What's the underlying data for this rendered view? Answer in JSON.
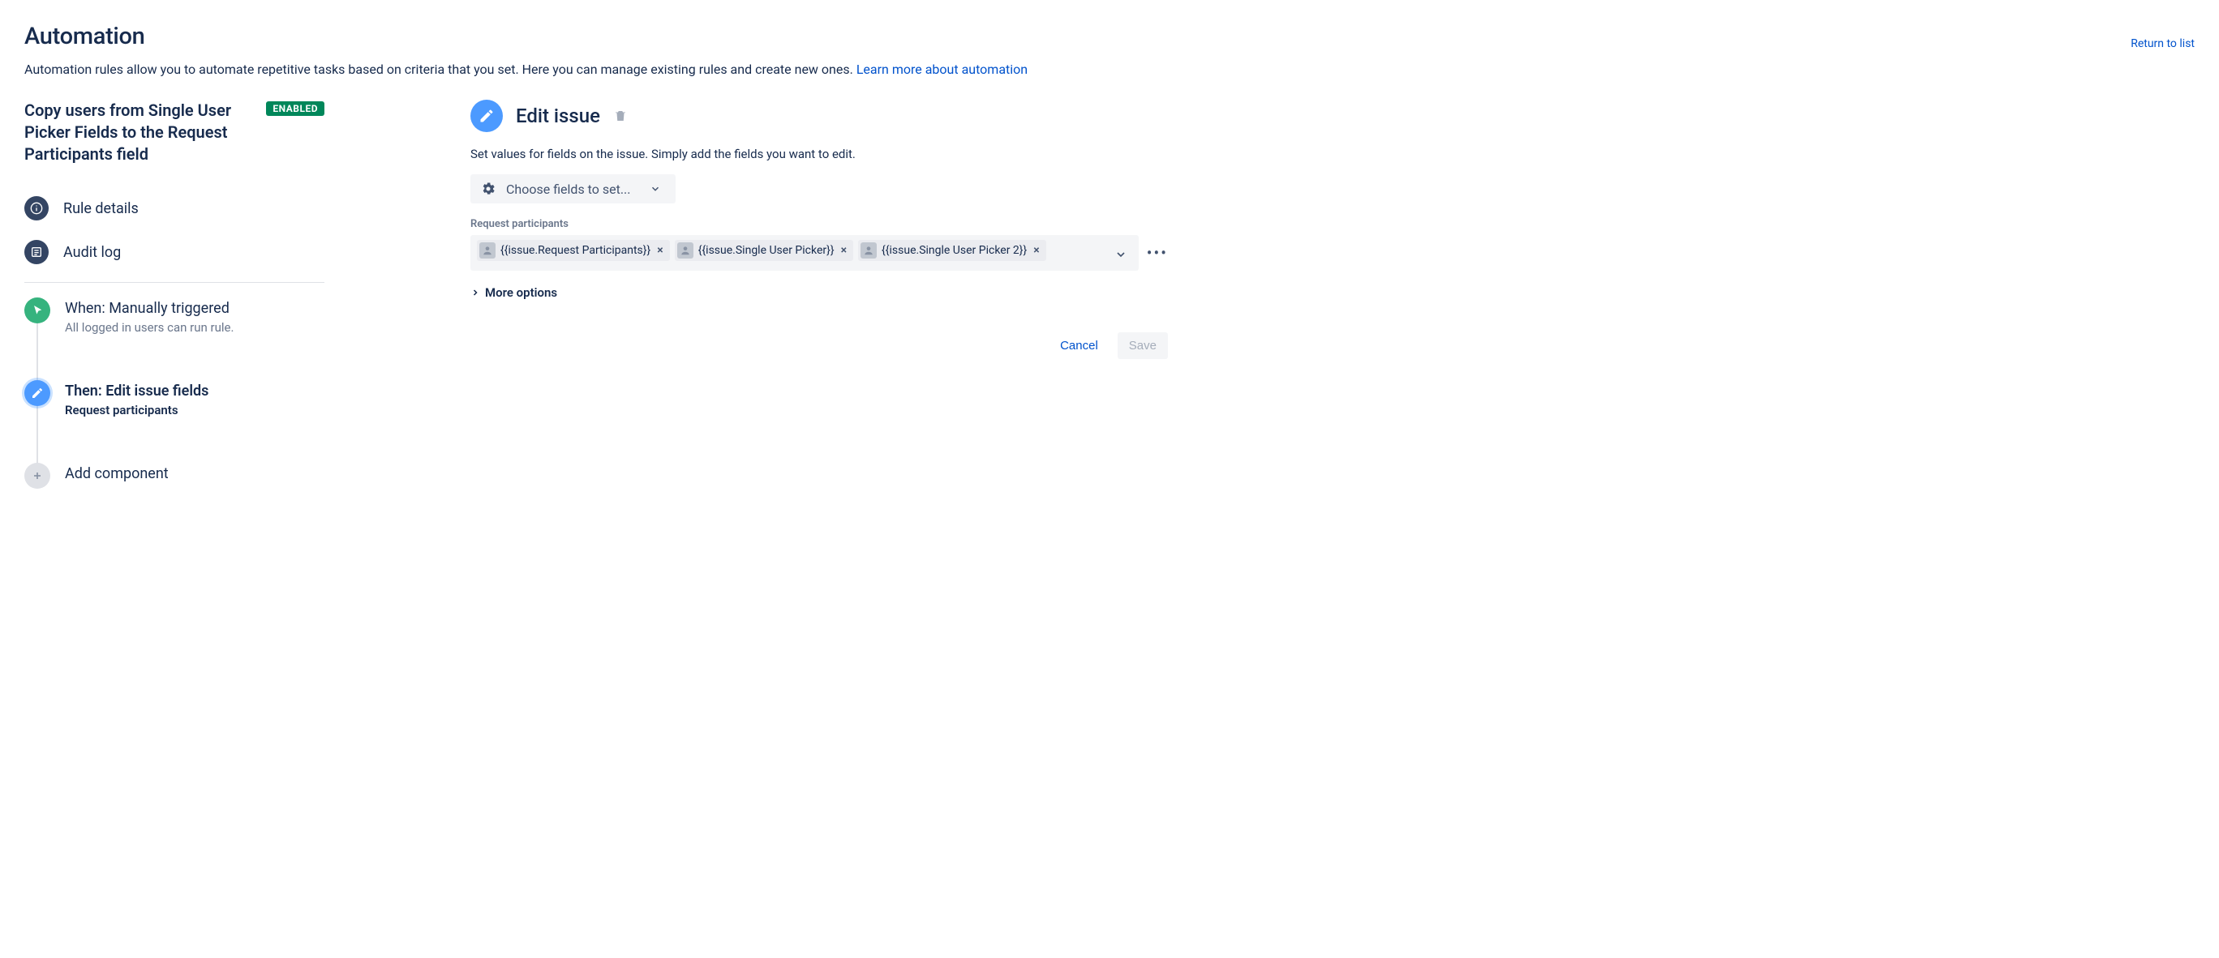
{
  "header": {
    "title": "Automation",
    "return_link": "Return to list",
    "description_prefix": "Automation rules allow you to automate repetitive tasks based on criteria that you set. Here you can manage existing rules and create new ones. ",
    "learn_more": "Learn more about automation"
  },
  "rule": {
    "name": "Copy users from Single User Picker Fields to the Request Participants field",
    "status": "ENABLED"
  },
  "sidebar": {
    "rule_details": "Rule details",
    "audit_log": "Audit log"
  },
  "flow": {
    "trigger": {
      "title": "When: Manually triggered",
      "sub": "All logged in users can run rule."
    },
    "action": {
      "title": "Then: Edit issue fields",
      "sub": "Request participants"
    },
    "add": {
      "title": "Add component"
    }
  },
  "panel": {
    "title": "Edit issue",
    "description": "Set values for fields on the issue. Simply add the fields you want to edit.",
    "choose_label": "Choose fields to set...",
    "field_label": "Request participants",
    "chips": [
      "{{issue.Request Participants}}",
      "{{issue.Single User Picker}}",
      "{{issue.Single User Picker 2}}"
    ],
    "more_options": "More options"
  },
  "footer": {
    "cancel": "Cancel",
    "save": "Save"
  }
}
